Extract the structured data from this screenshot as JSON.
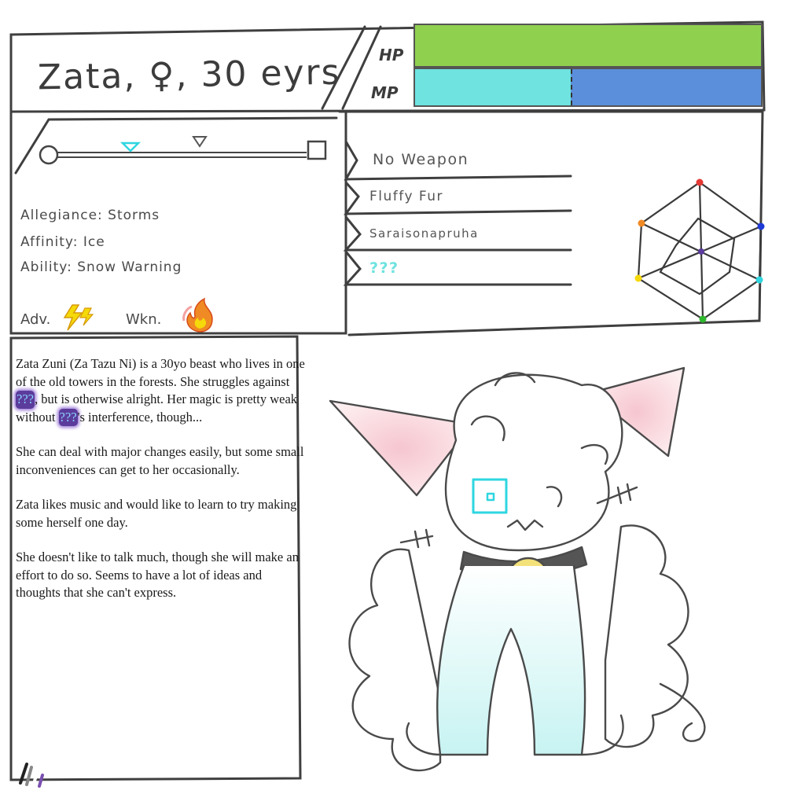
{
  "header": {
    "name_line": "Zata, ♀, 30 eyrs",
    "hp_label": "HP",
    "mp_label": "MP",
    "hp_fraction": 1.0,
    "mp_fraction": 0.45,
    "hp_color": "#8fd14f",
    "mp_color": "#5b8fdb",
    "mp_secondary_color": "#6ee3e0"
  },
  "info": {
    "allegiance": "Allegiance: Storms",
    "affinity": "Affinity: Ice",
    "ability": "Ability: Snow Warning",
    "adv_label": "Adv.",
    "wkn_label": "Wkn."
  },
  "gear": {
    "items": [
      "No Weapon",
      "Fluffy Fur",
      "Saraisonapruha",
      "???"
    ],
    "unknown_color": "#6ee3e0"
  },
  "stats_chart": {
    "vertex_colors": [
      "#e53935",
      "#1e3ad6",
      "#2ed6e0",
      "#2eb82e",
      "#f5d90a",
      "#f08a24"
    ]
  },
  "bio": {
    "p1_a": "Zata Zuni (Za Tazu Ni) is a 30yo beast who lives in one of the old towers in the forests. She struggles against",
    "p1_tag1": "???",
    "p1_b": ", but is otherwise alright. Her magic is pretty weak without",
    "p1_tag2": "???",
    "p1_c": "'s interference, though...",
    "p2": "She can deal with major changes easily, but some small inconveniences can get to her occasionally.",
    "p3": "Zata likes music and would like to learn to try making some herself one day.",
    "p4": "She doesn't like to talk much, though she will make an effort to do so. Seems to have a lot of ideas and thoughts that she can't express."
  }
}
